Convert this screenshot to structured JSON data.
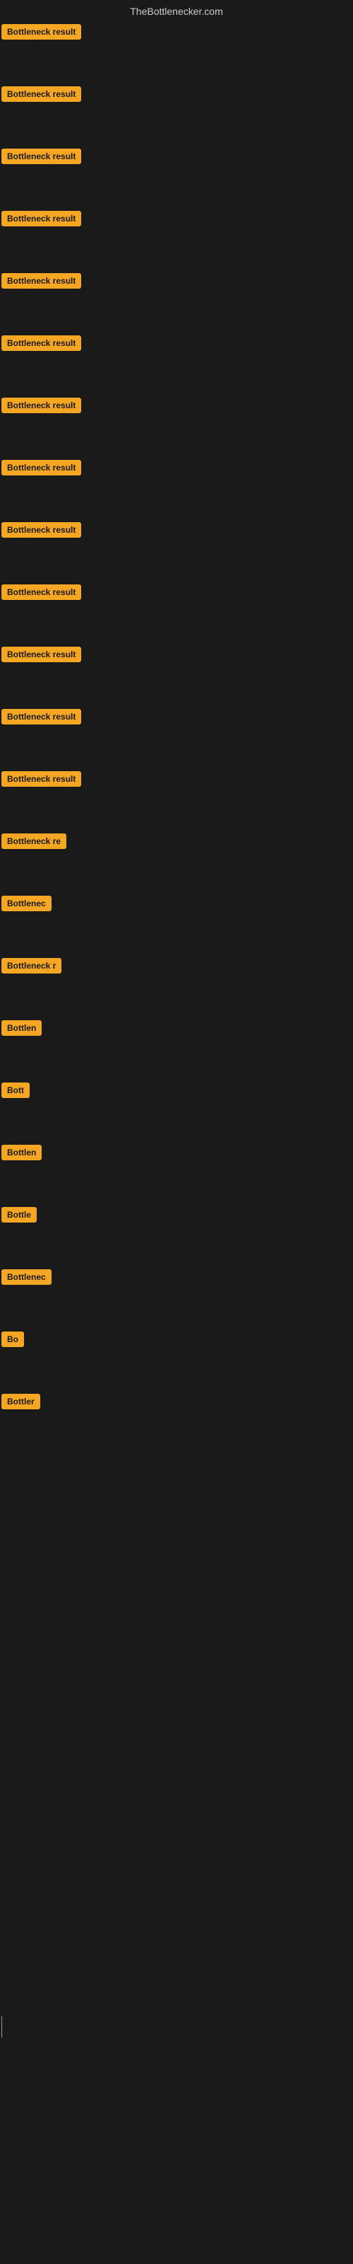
{
  "header": {
    "site_name": "TheBottlenecker.com"
  },
  "rows": [
    {
      "id": 0,
      "label": "Bottleneck result"
    },
    {
      "id": 1,
      "label": "Bottleneck result"
    },
    {
      "id": 2,
      "label": "Bottleneck result"
    },
    {
      "id": 3,
      "label": "Bottleneck result"
    },
    {
      "id": 4,
      "label": "Bottleneck result"
    },
    {
      "id": 5,
      "label": "Bottleneck result"
    },
    {
      "id": 6,
      "label": "Bottleneck result"
    },
    {
      "id": 7,
      "label": "Bottleneck result"
    },
    {
      "id": 8,
      "label": "Bottleneck result"
    },
    {
      "id": 9,
      "label": "Bottleneck result"
    },
    {
      "id": 10,
      "label": "Bottleneck result"
    },
    {
      "id": 11,
      "label": "Bottleneck result"
    },
    {
      "id": 12,
      "label": "Bottleneck result"
    },
    {
      "id": 13,
      "label": "Bottleneck re"
    },
    {
      "id": 14,
      "label": "Bottlenec"
    },
    {
      "id": 15,
      "label": "Bottleneck r"
    },
    {
      "id": 16,
      "label": "Bottlen"
    },
    {
      "id": 17,
      "label": "Bott"
    },
    {
      "id": 18,
      "label": "Bottlen"
    },
    {
      "id": 19,
      "label": "Bottle"
    },
    {
      "id": 20,
      "label": "Bottlenec"
    },
    {
      "id": 21,
      "label": "Bo"
    },
    {
      "id": 22,
      "label": "Bottler"
    }
  ]
}
